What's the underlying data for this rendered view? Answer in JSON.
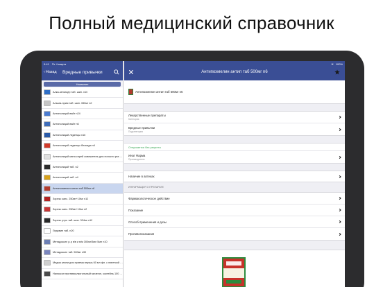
{
  "headline": "Полный медицинский справочник",
  "status_bar": {
    "time": "9:41",
    "date": "Пт 4 марта",
    "battery": "100%"
  },
  "left_pane": {
    "back_label": "Назад",
    "title": "Вредные привычки",
    "segment_label": "Название",
    "items": [
      {
        "label": "Алка-зельтцер таб. шип. n10",
        "color": "#2f6fc7"
      },
      {
        "label": "Альказ-прим таб. шип. 330мг n2",
        "color": "#c6c6c6"
      },
      {
        "label": "Антиполицай вайт n24",
        "color": "#4a7bd0"
      },
      {
        "label": "Антиполицай вайт n6",
        "color": "#3f6db9"
      },
      {
        "label": "Антиполицай леденцы n16",
        "color": "#2a5aa8"
      },
      {
        "label": "Антиполицай леденцы блокада n4",
        "color": "#d23a2a"
      },
      {
        "label": "Антиполицай мята спрей освежитель для полости рта 15мл",
        "color": "#e1e1e1"
      },
      {
        "label": "Антиполицай таб. n2",
        "color": "#2b2b2b"
      },
      {
        "label": "Антиполицай таб. n4",
        "color": "#d8a21a"
      },
      {
        "label": "Антипохмелин антип таб 500мг n6",
        "color": "#b23a2e"
      },
      {
        "label": "Зорекс капс. 250мг+10мг n10",
        "color": "#b32323"
      },
      {
        "label": "Зорекс капс. 250мг+10мг n2",
        "color": "#c73636"
      },
      {
        "label": "Зорекс утро таб. шип. 324мг n10",
        "color": "#2a2a2a"
      },
      {
        "label": "Ледовин таб. n20",
        "color": "#ffffff"
      },
      {
        "label": "Метадоксил р-р в/в и в/м 300мг/5мл 5мл n10",
        "color": "#6d7fb5"
      },
      {
        "label": "Метадоксил таб. 500мг n30",
        "color": "#7b86bf"
      },
      {
        "label": "Медиа капли для приема внутрь 60 мл фл. с пипеткой n1",
        "color": "#cfcfcf"
      },
      {
        "label": "Налоксон противоалкогольный мочегон, коктейль 100 мл n1",
        "color": "#4a4a4a"
      }
    ],
    "selected_index": 9
  },
  "detail": {
    "title": "Антипохмелин антип таб 500мг n6",
    "product_name": "Антипохмелин антип таб 500мг n6",
    "category": {
      "label": "Лекарственные препараты",
      "sub": "Категория"
    },
    "subcategory": {
      "label": "Вредные привычки",
      "sub": "Подкатегория"
    },
    "rx_note": "Отпускается без рецепта",
    "manufacturer": {
      "label": "Инат Фарма",
      "sub": "Производитель"
    },
    "availability": "Наличие в аптеках",
    "info_section_header": "ИНФОРМАЦИЯ О ПРЕПАРАТЕ",
    "info_rows": [
      "Фармакологическое действие",
      "Показание",
      "Способ применения и дозы",
      "Противопоказания"
    ]
  }
}
